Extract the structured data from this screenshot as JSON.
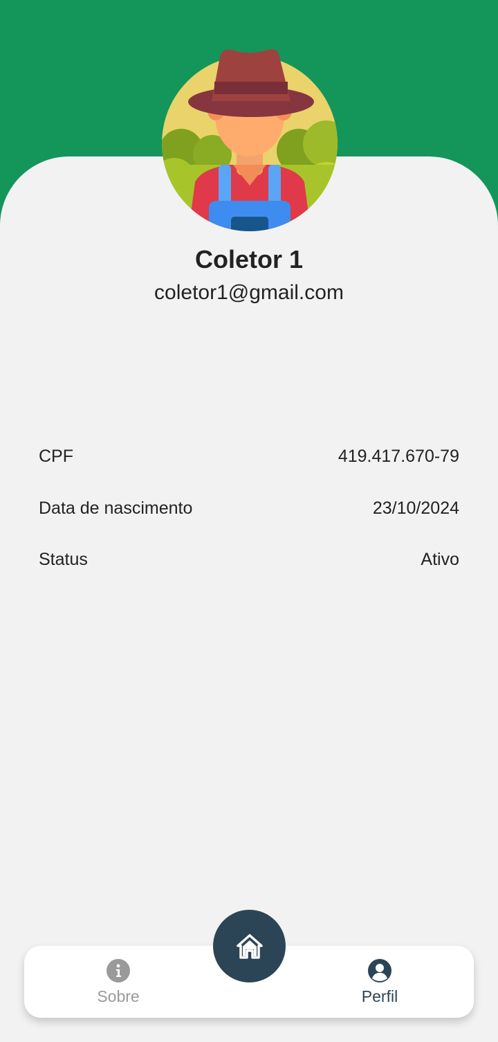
{
  "profile": {
    "name": "Coletor 1",
    "email": "coletor1@gmail.com",
    "avatar_icon": "farmer-avatar-icon"
  },
  "details": {
    "cpf": {
      "label": "CPF",
      "value": "419.417.670-79"
    },
    "birth_date": {
      "label": "Data de nascimento",
      "value": "23/10/2024"
    },
    "status": {
      "label": "Status",
      "value": "Ativo"
    }
  },
  "bottom_nav": {
    "about": {
      "label": "Sobre",
      "icon": "info-icon",
      "active": false
    },
    "home": {
      "icon": "home-icon"
    },
    "profile": {
      "label": "Perfil",
      "icon": "user-circle-icon",
      "active": true
    }
  },
  "colors": {
    "header_green": "#14955a",
    "background": "#f2f2f2",
    "accent_dark": "#2c4556",
    "inactive": "#9a9a9a"
  }
}
